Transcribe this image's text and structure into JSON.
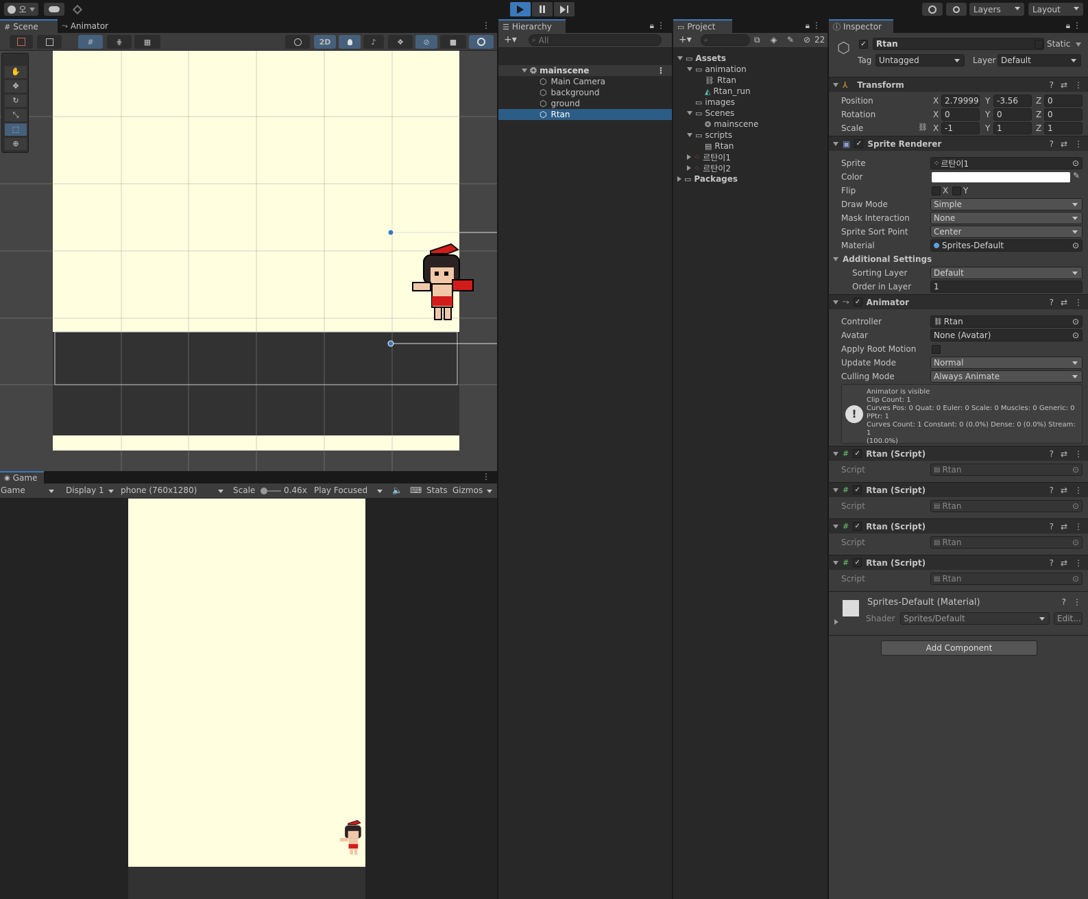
{
  "topbar": {
    "account_label": "오",
    "layers_label": "Layers",
    "layout_label": "Layout"
  },
  "scene_panel": {
    "tabs": [
      "Scene",
      "Animator"
    ],
    "mode_2d_label": "2D"
  },
  "game_panel": {
    "tab_label": "Game",
    "game_dropdown": "Game",
    "display_dropdown": "Display 1",
    "resolution_dropdown": "phone (760x1280)",
    "scale_label": "Scale",
    "scale_value": "0.46x",
    "play_focused": "Play Focused",
    "stats_label": "Stats",
    "gizmos_label": "Gizmos"
  },
  "hierarchy": {
    "tab_label": "Hierarchy",
    "search_placeholder": "All",
    "scene_name": "mainscene",
    "items": [
      "Main Camera",
      "background",
      "ground",
      "Rtan"
    ],
    "selected": "Rtan"
  },
  "project": {
    "tab_label": "Project",
    "hidden_count": "22",
    "tree": [
      {
        "label": "Assets",
        "depth": 0,
        "kind": "folder-open",
        "bold": true
      },
      {
        "label": "animation",
        "depth": 1,
        "kind": "folder-open"
      },
      {
        "label": "Rtan",
        "depth": 2,
        "kind": "controller"
      },
      {
        "label": "Rtan_run",
        "depth": 2,
        "kind": "anim"
      },
      {
        "label": "images",
        "depth": 1,
        "kind": "folder"
      },
      {
        "label": "Scenes",
        "depth": 1,
        "kind": "folder-open"
      },
      {
        "label": "mainscene",
        "depth": 2,
        "kind": "scene"
      },
      {
        "label": "scripts",
        "depth": 1,
        "kind": "folder-open"
      },
      {
        "label": "Rtan",
        "depth": 2,
        "kind": "script"
      },
      {
        "label": "르탄이1",
        "depth": 1,
        "kind": "sprite"
      },
      {
        "label": "르탄이2",
        "depth": 1,
        "kind": "sprite"
      },
      {
        "label": "Packages",
        "depth": 0,
        "kind": "folder",
        "bold": true
      }
    ]
  },
  "inspector": {
    "tab_label": "Inspector",
    "object_name": "Rtan",
    "static_label": "Static",
    "tag_label": "Tag",
    "tag_value": "Untagged",
    "layer_label": "Layer",
    "layer_value": "Default",
    "transform": {
      "title": "Transform",
      "position_label": "Position",
      "rotation_label": "Rotation",
      "scale_label": "Scale",
      "position": {
        "x": "2.799999",
        "y": "-3.56",
        "z": "0"
      },
      "rotation": {
        "x": "0",
        "y": "0",
        "z": "0"
      },
      "scale": {
        "x": "-1",
        "y": "1",
        "z": "1"
      }
    },
    "sprite_renderer": {
      "title": "Sprite Renderer",
      "sprite_label": "Sprite",
      "sprite_value": "르탄이1",
      "color_label": "Color",
      "flip_label": "Flip",
      "flip_x": "X",
      "flip_y": "Y",
      "draw_mode_label": "Draw Mode",
      "draw_mode": "Simple",
      "mask_label": "Mask Interaction",
      "mask_value": "None",
      "sort_point_label": "Sprite Sort Point",
      "sort_point": "Center",
      "material_label": "Material",
      "material_value": "Sprites-Default",
      "additional_label": "Additional Settings",
      "sorting_layer_label": "Sorting Layer",
      "sorting_layer": "Default",
      "order_label": "Order in Layer",
      "order_value": "1"
    },
    "animator": {
      "title": "Animator",
      "controller_label": "Controller",
      "controller_value": "Rtan",
      "avatar_label": "Avatar",
      "avatar_value": "None (Avatar)",
      "root_motion_label": "Apply Root Motion",
      "update_mode_label": "Update Mode",
      "update_mode": "Normal",
      "culling_label": "Culling Mode",
      "culling_mode": "Always Animate",
      "info_lines": [
        "Animator is visible",
        "Clip Count: 1",
        "Curves Pos: 0 Quat: 0 Euler: 0 Scale: 0 Muscles: 0 Generic: 0",
        "PPtr: 1",
        "Curves Count: 1 Constant: 0 (0.0%) Dense: 0 (0.0%) Stream: 1",
        "(100.0%)"
      ]
    },
    "scripts": [
      {
        "title": "Rtan (Script)",
        "field_label": "Script",
        "value": "Rtan"
      },
      {
        "title": "Rtan (Script)",
        "field_label": "Script",
        "value": "Rtan"
      },
      {
        "title": "Rtan (Script)",
        "field_label": "Script",
        "value": "Rtan"
      },
      {
        "title": "Rtan (Script)",
        "field_label": "Script",
        "value": "Rtan"
      }
    ],
    "material": {
      "title": "Sprites-Default (Material)",
      "shader_label": "Shader",
      "shader_value": "Sprites/Default",
      "edit_label": "Edit..."
    },
    "add_component_label": "Add Component"
  },
  "colors": {
    "accent": "#3a79bb",
    "selection": "#2c5d87",
    "scene_bg": "#ffffe0",
    "panel": "#282828"
  }
}
